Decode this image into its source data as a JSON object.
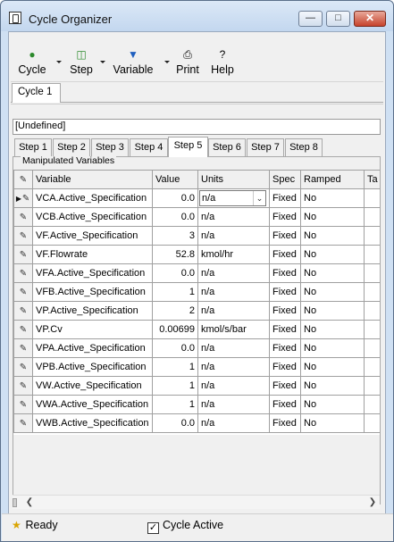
{
  "window": {
    "title": "Cycle Organizer"
  },
  "toolbar": {
    "cycle": "Cycle",
    "step": "Step",
    "variable": "Variable",
    "print": "Print",
    "help": "Help"
  },
  "cycle_tabs": [
    "Cycle 1"
  ],
  "step_field": "[Undefined]",
  "step_tabs": [
    "Step 1",
    "Step 2",
    "Step 3",
    "Step 4",
    "Step 5",
    "Step 6",
    "Step 7",
    "Step 8"
  ],
  "active_step_tab": "Step 5",
  "group": {
    "label": "Manipulated Variables"
  },
  "grid": {
    "headers": [
      "Variable",
      "Value",
      "Units",
      "Spec",
      "Ramped",
      "Ta"
    ],
    "rows": [
      {
        "variable": "VCA.Active_Specification",
        "value": "0.0",
        "units": "n/a",
        "spec": "Fixed",
        "ramped": "No"
      },
      {
        "variable": "VCB.Active_Specification",
        "value": "0.0",
        "units": "n/a",
        "spec": "Fixed",
        "ramped": "No"
      },
      {
        "variable": "VF.Active_Specification",
        "value": "3",
        "units": "n/a",
        "spec": "Fixed",
        "ramped": "No"
      },
      {
        "variable": "VF.Flowrate",
        "value": "52.8",
        "units": "kmol/hr",
        "spec": "Fixed",
        "ramped": "No"
      },
      {
        "variable": "VFA.Active_Specification",
        "value": "0.0",
        "units": "n/a",
        "spec": "Fixed",
        "ramped": "No"
      },
      {
        "variable": "VFB.Active_Specification",
        "value": "1",
        "units": "n/a",
        "spec": "Fixed",
        "ramped": "No"
      },
      {
        "variable": "VP.Active_Specification",
        "value": "2",
        "units": "n/a",
        "spec": "Fixed",
        "ramped": "No"
      },
      {
        "variable": "VP.Cv",
        "value": "0.00699",
        "units": "kmol/s/bar",
        "spec": "Fixed",
        "ramped": "No"
      },
      {
        "variable": "VPA.Active_Specification",
        "value": "0.0",
        "units": "n/a",
        "spec": "Fixed",
        "ramped": "No"
      },
      {
        "variable": "VPB.Active_Specification",
        "value": "1",
        "units": "n/a",
        "spec": "Fixed",
        "ramped": "No"
      },
      {
        "variable": "VW.Active_Specification",
        "value": "1",
        "units": "n/a",
        "spec": "Fixed",
        "ramped": "No"
      },
      {
        "variable": "VWA.Active_Specification",
        "value": "1",
        "units": "n/a",
        "spec": "Fixed",
        "ramped": "No"
      },
      {
        "variable": "VWB.Active_Specification",
        "value": "0.0",
        "units": "n/a",
        "spec": "Fixed",
        "ramped": "No"
      }
    ]
  },
  "status": {
    "ready": "Ready",
    "cycle_active": "Cycle Active"
  },
  "icons": {
    "pencil": "pencil-icon",
    "bulb": "lightbulb-icon"
  }
}
